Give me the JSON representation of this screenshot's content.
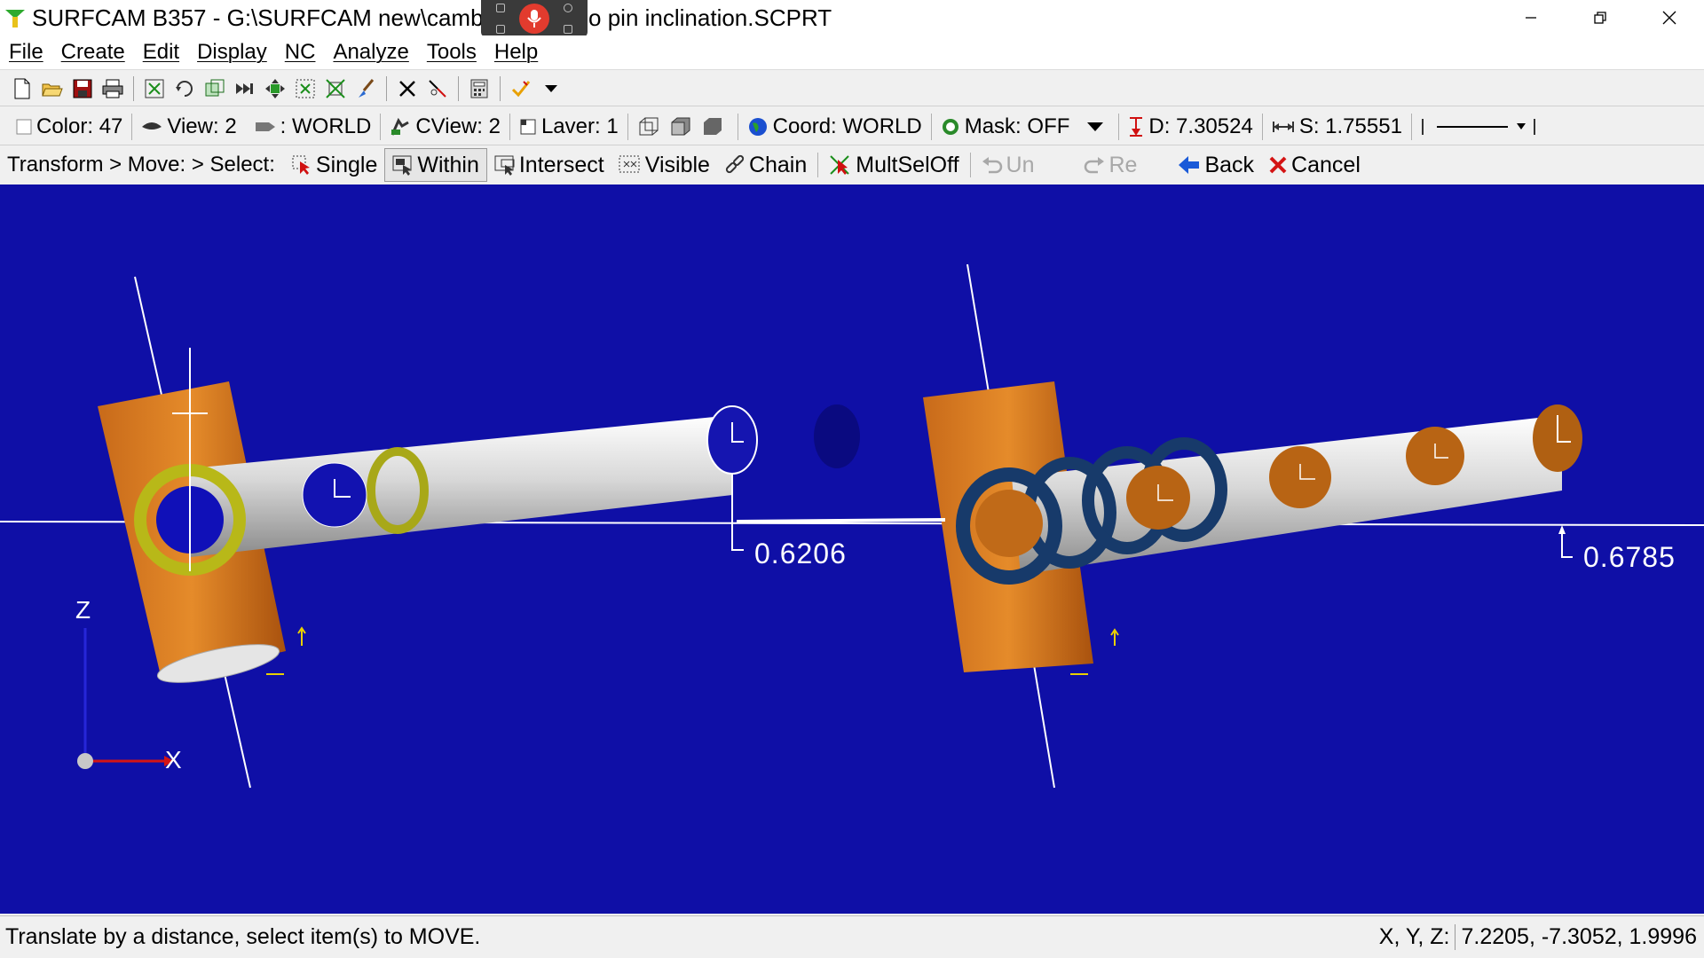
{
  "window": {
    "title": "SURFCAM B357 - G:\\SURFCAM new\\camber   cturer\\no pin inclination.SCPRT"
  },
  "menu": [
    "File",
    "Create",
    "Edit",
    "Display",
    "NC",
    "Analyze",
    "Tools",
    "Help"
  ],
  "toolbar_icons": [
    "new-file-icon",
    "open-folder-icon",
    "save-icon",
    "print-icon",
    "zoom-extents-icon",
    "rotate-view-icon",
    "zoom-window-icon",
    "fast-forward-icon",
    "pan-icon",
    "zoom-in-icon",
    "zoom-out-icon",
    "brush-icon",
    "delete-x-icon",
    "trim-icon",
    "calculator-icon",
    "checkmark-icon",
    "dropdown-arrow-icon"
  ],
  "status": {
    "color": "Color: 47",
    "view": "View: 2",
    "world": ": WORLD",
    "cview": "CView: 2",
    "layer": "Laver: 1",
    "coord": "Coord: WORLD",
    "mask": "Mask: OFF",
    "depth": "D: 7.30524",
    "step": "S: 1.75551"
  },
  "prompt": {
    "path": "Transform > Move: > Select:",
    "single": "Single",
    "within": "Within",
    "intersect": "Intersect",
    "visible": "Visible",
    "chain": "Chain",
    "multsel": "MultSelOff",
    "undo": "Un",
    "redo": "Re",
    "back": "Back",
    "cancel": "Cancel"
  },
  "viewport": {
    "dim_left": "0.6206",
    "dim_right": "0.6785",
    "axis_z": "Z",
    "axis_x": "X",
    "background": "#0f0fa6"
  },
  "bottom": {
    "message": "Translate by a distance, select item(s) to MOVE.",
    "xyz_label": "X, Y, Z:",
    "xyz_value": "7.2205, -7.3052, 1.9996"
  }
}
